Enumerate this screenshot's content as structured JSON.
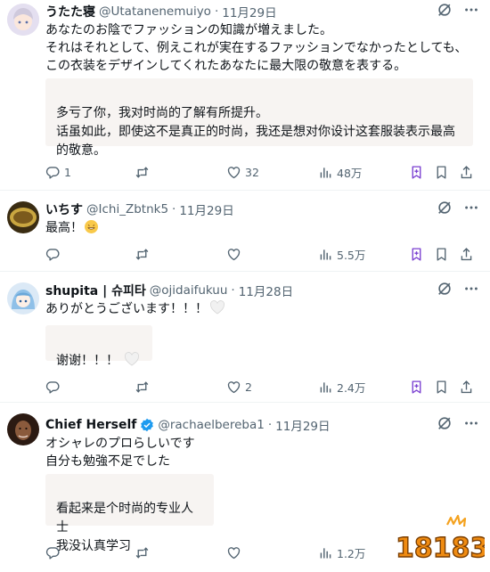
{
  "colors": {
    "accent": "#1d9bf0",
    "muted": "#536471",
    "bookmark": "#7a3fd1",
    "translation_bg": "#f7f4f2"
  },
  "tweets": [
    {
      "name": "うたた寝",
      "handle": "@Utatanenemuiyo",
      "dot": "·",
      "date": "11月29日",
      "text": "あなたのお陰でファッションの知識が増えました。\nそれはそれとして、例えこれが実在するファッションでなかったとしても、\nこの衣装をデザインしてくれたあなたに最大限の敬意を表する。",
      "translation": "多亏了你，我对时尚的了解有所提升。\n话虽如此，即使这不是真正的时尚，我还是想对你设计这套服装表示最高\n的敬意。",
      "replies": "1",
      "retweets": "",
      "likes": "32",
      "views": "48万"
    },
    {
      "name": "いちす",
      "handle": "@Ichi_Zbtnk5",
      "dot": "·",
      "date": "11月29日",
      "text": "最高！",
      "replies": "",
      "retweets": "",
      "likes": "",
      "views": "5.5万"
    },
    {
      "name": "shupita | 슈피타",
      "handle": "@ojidaifukuu",
      "dot": "·",
      "date": "11月28日",
      "text": "ありがとうございます！！！",
      "translation": "谢谢！！！",
      "replies": "",
      "retweets": "",
      "likes": "2",
      "views": "2.4万"
    },
    {
      "name": "Chief Herself",
      "handle": "@rachaelbereba1",
      "dot": "·",
      "date": "11月29日",
      "text": "オシャレのプロらしいです\n自分も勉強不足でした",
      "translation": "看起来是个时尚的专业人士\n我没认真学习",
      "replies": "",
      "retweets": "",
      "likes": "",
      "views": "1.2万"
    }
  ],
  "icons": {
    "grok": "grok-icon",
    "more": "more-icon",
    "reply": "reply-icon",
    "retweet": "retweet-icon",
    "like": "heart-icon",
    "views": "views-icon",
    "bookmark": "bookmark-icon",
    "share": "share-icon",
    "download": "download-icon"
  },
  "watermark": "18183"
}
